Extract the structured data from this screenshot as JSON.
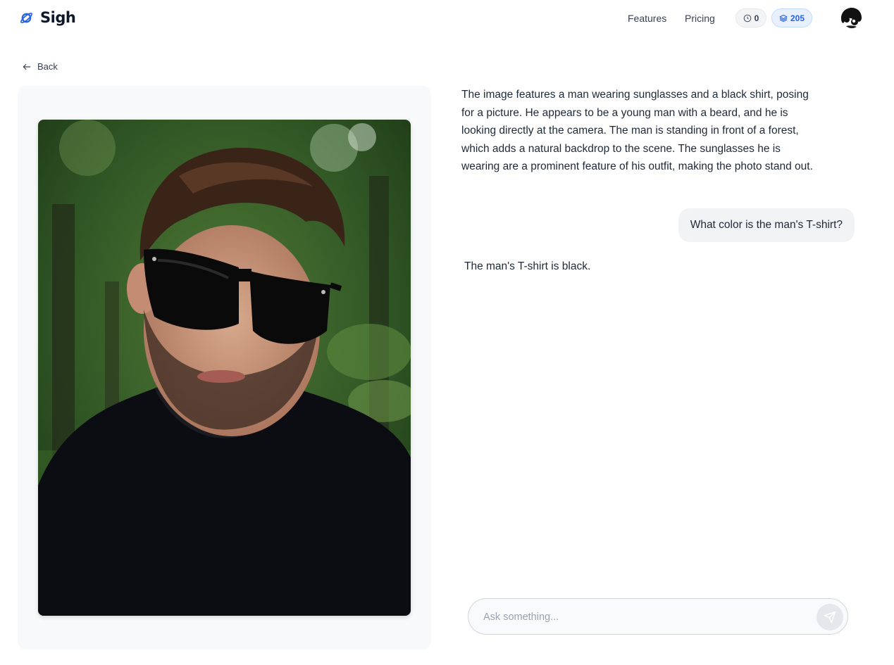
{
  "brand": {
    "name": "Sigh",
    "icon": "planet-icon",
    "accent": "#2563eb"
  },
  "nav": {
    "features_label": "Features",
    "pricing_label": "Pricing"
  },
  "stats": {
    "history_icon": "clock-icon",
    "history_count": "0",
    "credits_icon": "layers-icon",
    "credits_count": "205"
  },
  "user": {
    "avatar_icon": "user-avatar"
  },
  "back": {
    "label": "Back",
    "icon": "arrow-left-icon"
  },
  "image": {
    "alt_icon": "uploaded-photo"
  },
  "chat": {
    "messages": [
      {
        "role": "assistant",
        "text": " The image features a man wearing sunglasses and a black shirt, posing for a picture. He appears to be a young man with a beard, and he is looking directly at the camera. The man is standing in front of a forest, which adds a natural backdrop to the scene. The sunglasses he is wearing are a prominent feature of his outfit, making the photo stand out."
      },
      {
        "role": "user",
        "text": "What color is the man's T-shirt?"
      },
      {
        "role": "assistant",
        "text": " The man's T-shirt is black."
      }
    ]
  },
  "composer": {
    "placeholder": "Ask something...",
    "send_icon": "send-icon"
  }
}
